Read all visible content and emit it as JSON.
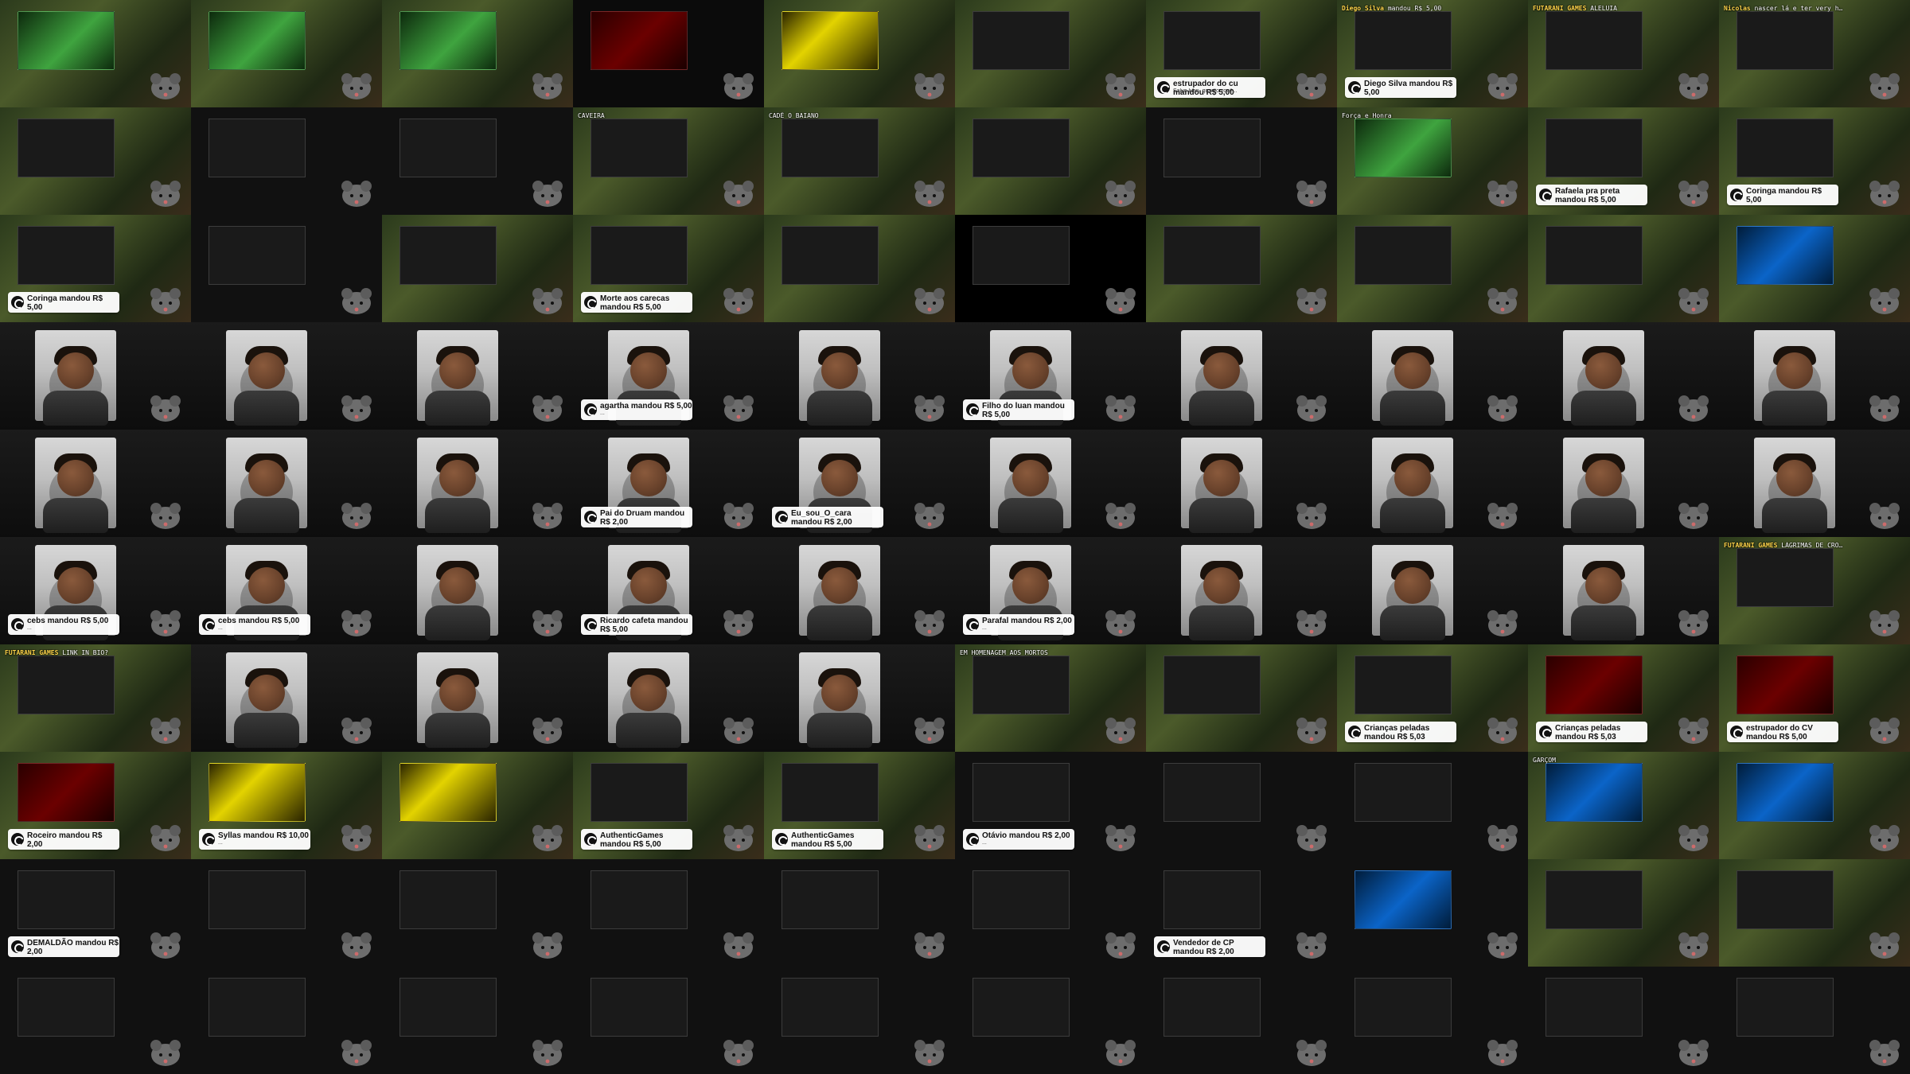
{
  "tiles": [
    {
      "row": 0,
      "col": 0,
      "kind": "jungle",
      "thumb": "green",
      "badge": "",
      "chat": [],
      "toast": null
    },
    {
      "row": 0,
      "col": 1,
      "kind": "jungle",
      "thumb": "green",
      "badge": "",
      "chat": [],
      "toast": null
    },
    {
      "row": 0,
      "col": 2,
      "kind": "jungle",
      "thumb": "green",
      "badge": "",
      "chat": [],
      "toast": null
    },
    {
      "row": 0,
      "col": 3,
      "kind": "news",
      "thumb": "red",
      "badge": "",
      "chat": [],
      "toast": null
    },
    {
      "row": 0,
      "col": 4,
      "kind": "jungle",
      "thumb": "yellow",
      "badge": "",
      "chat": [],
      "toast": null
    },
    {
      "row": 0,
      "col": 5,
      "kind": "jungle",
      "thumb": "dark",
      "badge": "",
      "chat": [],
      "toast": null
    },
    {
      "row": 0,
      "col": 6,
      "kind": "jungle",
      "thumb": "dark",
      "badge": "",
      "chat": [],
      "toast": {
        "title": "estrupador do cu mandou R$ 5,00",
        "body": "Salve luan, quanto você..."
      }
    },
    {
      "row": 0,
      "col": 7,
      "kind": "jungle",
      "thumb": "dark",
      "badge": "",
      "chat": [
        {
          "u": "Diego Silva",
          "m": "mandou R$ 5,00"
        }
      ],
      "toast": {
        "title": "Diego Silva mandou R$ 5,00",
        "body": "..."
      }
    },
    {
      "row": 0,
      "col": 8,
      "kind": "jungle",
      "thumb": "dark",
      "badge": "",
      "chat": [
        {
          "u": "FUTARANI GAMES",
          "m": "ALELUIA"
        }
      ],
      "toast": null
    },
    {
      "row": 0,
      "col": 9,
      "kind": "jungle",
      "thumb": "dark",
      "badge": "",
      "chat": [
        {
          "u": "Nicolas",
          "m": "nascer lá e ter very hard"
        }
      ],
      "toast": null
    },
    {
      "row": 1,
      "col": 0,
      "kind": "jungle",
      "thumb": "dark",
      "badge": "",
      "chat": [],
      "toast": null
    },
    {
      "row": 1,
      "col": 1,
      "kind": "dark",
      "thumb": "dark",
      "badge": "",
      "chat": [],
      "toast": null
    },
    {
      "row": 1,
      "col": 2,
      "kind": "dark",
      "thumb": "dark",
      "badge": "",
      "chat": [],
      "toast": null
    },
    {
      "row": 1,
      "col": 3,
      "kind": "jungle",
      "thumb": "dark",
      "badge": "",
      "chat": [
        {
          "u": "",
          "m": "CAVEIRA"
        }
      ],
      "toast": null
    },
    {
      "row": 1,
      "col": 4,
      "kind": "jungle",
      "thumb": "dark",
      "badge": "",
      "chat": [
        {
          "u": "",
          "m": "CADÊ O BAIANO"
        }
      ],
      "toast": null
    },
    {
      "row": 1,
      "col": 5,
      "kind": "jungle",
      "thumb": "dark",
      "badge": "",
      "chat": [],
      "toast": null
    },
    {
      "row": 1,
      "col": 6,
      "kind": "dark",
      "thumb": "dark",
      "badge": "",
      "chat": [],
      "toast": null
    },
    {
      "row": 1,
      "col": 7,
      "kind": "jungle",
      "thumb": "green",
      "badge": "",
      "chat": [
        {
          "u": "",
          "m": "Força e Honra"
        }
      ],
      "toast": null
    },
    {
      "row": 1,
      "col": 8,
      "kind": "jungle",
      "thumb": "dark",
      "badge": "",
      "chat": [],
      "toast": {
        "title": "Rafaela pra preta mandou R$ 5,00",
        "body": "..."
      }
    },
    {
      "row": 1,
      "col": 9,
      "kind": "jungle",
      "thumb": "dark",
      "badge": "",
      "chat": [],
      "toast": {
        "title": "Coringa mandou R$ 5,00",
        "body": "..."
      }
    },
    {
      "row": 2,
      "col": 0,
      "kind": "jungle",
      "thumb": "dark",
      "badge": "",
      "chat": [],
      "toast": {
        "title": "Coringa mandou R$ 5,00",
        "body": "..."
      }
    },
    {
      "row": 2,
      "col": 1,
      "kind": "dark",
      "thumb": "dark",
      "badge": "",
      "chat": [],
      "toast": null
    },
    {
      "row": 2,
      "col": 2,
      "kind": "jungle",
      "thumb": "dark",
      "badge": "",
      "chat": [],
      "toast": null
    },
    {
      "row": 2,
      "col": 3,
      "kind": "jungle",
      "thumb": "dark",
      "badge": "",
      "chat": [],
      "toast": {
        "title": "Morte aos carecas mandou R$ 5,00",
        "body": "..."
      }
    },
    {
      "row": 2,
      "col": 4,
      "kind": "jungle",
      "thumb": "dark",
      "badge": "",
      "chat": [],
      "toast": null
    },
    {
      "row": 2,
      "col": 5,
      "kind": "black",
      "thumb": "dark",
      "badge": "",
      "chat": [],
      "toast": null
    },
    {
      "row": 2,
      "col": 6,
      "kind": "jungle",
      "thumb": "dark",
      "badge": "",
      "chat": [],
      "toast": null
    },
    {
      "row": 2,
      "col": 7,
      "kind": "jungle",
      "thumb": "dark",
      "badge": "",
      "chat": [],
      "toast": null
    },
    {
      "row": 2,
      "col": 8,
      "kind": "jungle",
      "thumb": "dark",
      "badge": "",
      "chat": [],
      "toast": null
    },
    {
      "row": 2,
      "col": 9,
      "kind": "jungle",
      "thumb": "blue",
      "badge": "",
      "chat": [],
      "toast": null
    },
    {
      "row": 3,
      "col": 0,
      "kind": "room",
      "thumb": "blue",
      "badge": "",
      "chat": [],
      "toast": null
    },
    {
      "row": 3,
      "col": 1,
      "kind": "room",
      "thumb": null,
      "badge": "",
      "chat": [],
      "toast": null
    },
    {
      "row": 3,
      "col": 2,
      "kind": "room",
      "thumb": null,
      "badge": "",
      "chat": [],
      "toast": null
    },
    {
      "row": 3,
      "col": 3,
      "kind": "room",
      "thumb": null,
      "badge": "",
      "chat": [],
      "toast": {
        "title": "agartha mandou R$ 5,00",
        "body": "..."
      }
    },
    {
      "row": 3,
      "col": 4,
      "kind": "room",
      "thumb": null,
      "badge": "",
      "chat": [],
      "toast": null
    },
    {
      "row": 3,
      "col": 5,
      "kind": "room",
      "thumb": "yellow",
      "badge": "",
      "chat": [],
      "toast": {
        "title": "Filho do luan mandou R$ 5,00",
        "body": "..."
      }
    },
    {
      "row": 3,
      "col": 6,
      "kind": "room",
      "thumb": null,
      "badge": "",
      "chat": [],
      "toast": null
    },
    {
      "row": 3,
      "col": 7,
      "kind": "room",
      "thumb": null,
      "badge": "",
      "chat": [],
      "toast": null
    },
    {
      "row": 3,
      "col": 8,
      "kind": "room",
      "thumb": null,
      "badge": "",
      "chat": [],
      "toast": null
    },
    {
      "row": 3,
      "col": 9,
      "kind": "room",
      "thumb": null,
      "badge": "",
      "chat": [],
      "toast": null
    },
    {
      "row": 4,
      "col": 0,
      "kind": "room",
      "thumb": null,
      "badge": "",
      "chat": [],
      "toast": null
    },
    {
      "row": 4,
      "col": 1,
      "kind": "room",
      "thumb": null,
      "badge": "",
      "chat": [],
      "toast": null
    },
    {
      "row": 4,
      "col": 2,
      "kind": "room",
      "thumb": null,
      "badge": "",
      "chat": [],
      "toast": null
    },
    {
      "row": 4,
      "col": 3,
      "kind": "room",
      "thumb": null,
      "badge": "",
      "chat": [],
      "toast": {
        "title": "Pai do Druam mandou R$ 2,00",
        "body": "..."
      }
    },
    {
      "row": 4,
      "col": 4,
      "kind": "room",
      "thumb": null,
      "badge": "",
      "chat": [],
      "toast": {
        "title": "Eu_sou_O_cara mandou R$ 2,00",
        "body": "..."
      }
    },
    {
      "row": 4,
      "col": 5,
      "kind": "room",
      "thumb": null,
      "badge": "",
      "chat": [],
      "toast": null
    },
    {
      "row": 4,
      "col": 6,
      "kind": "room",
      "thumb": null,
      "badge": "",
      "chat": [],
      "toast": null
    },
    {
      "row": 4,
      "col": 7,
      "kind": "room",
      "thumb": null,
      "badge": "",
      "chat": [],
      "toast": null
    },
    {
      "row": 4,
      "col": 8,
      "kind": "room",
      "thumb": null,
      "badge": "",
      "chat": [],
      "toast": null
    },
    {
      "row": 4,
      "col": 9,
      "kind": "room",
      "thumb": null,
      "badge": "",
      "chat": [],
      "toast": null
    },
    {
      "row": 5,
      "col": 0,
      "kind": "room",
      "thumb": null,
      "badge": "",
      "chat": [],
      "toast": {
        "title": "cebs mandou R$ 5,00",
        "body": "..."
      }
    },
    {
      "row": 5,
      "col": 1,
      "kind": "room",
      "thumb": null,
      "badge": "",
      "chat": [],
      "toast": {
        "title": "cebs mandou R$ 5,00",
        "body": "..."
      }
    },
    {
      "row": 5,
      "col": 2,
      "kind": "room",
      "thumb": null,
      "badge": "",
      "chat": [],
      "toast": null
    },
    {
      "row": 5,
      "col": 3,
      "kind": "room",
      "thumb": null,
      "badge": "",
      "chat": [],
      "toast": {
        "title": "Ricardo cafeta mandou R$ 5,00",
        "body": "..."
      }
    },
    {
      "row": 5,
      "col": 4,
      "kind": "room",
      "thumb": null,
      "badge": "",
      "chat": [],
      "toast": null
    },
    {
      "row": 5,
      "col": 5,
      "kind": "room",
      "thumb": null,
      "badge": "",
      "chat": [],
      "toast": {
        "title": "Parafal mandou R$ 2,00",
        "body": "..."
      }
    },
    {
      "row": 5,
      "col": 6,
      "kind": "room",
      "thumb": null,
      "badge": "",
      "chat": [],
      "toast": null
    },
    {
      "row": 5,
      "col": 7,
      "kind": "room",
      "thumb": null,
      "badge": "",
      "chat": [],
      "toast": null
    },
    {
      "row": 5,
      "col": 8,
      "kind": "room",
      "thumb": null,
      "badge": "",
      "chat": [],
      "toast": null
    },
    {
      "row": 5,
      "col": 9,
      "kind": "jungle",
      "thumb": "dark",
      "badge": "",
      "chat": [
        {
          "u": "FUTARANI GAMES",
          "m": "LÁGRIMAS DE CROCODILO"
        }
      ],
      "toast": null
    },
    {
      "row": 6,
      "col": 0,
      "kind": "jungle",
      "thumb": "dark",
      "badge": "",
      "chat": [
        {
          "u": "FUTARANI GAMES",
          "m": "LINK IN BIO?"
        }
      ],
      "toast": null
    },
    {
      "row": 6,
      "col": 1,
      "kind": "room",
      "thumb": null,
      "badge": "",
      "chat": [],
      "toast": null
    },
    {
      "row": 6,
      "col": 2,
      "kind": "room",
      "thumb": null,
      "badge": "",
      "chat": [],
      "toast": null
    },
    {
      "row": 6,
      "col": 3,
      "kind": "room",
      "thumb": null,
      "badge": "",
      "chat": [],
      "toast": null
    },
    {
      "row": 6,
      "col": 4,
      "kind": "room",
      "thumb": null,
      "badge": "",
      "chat": [],
      "toast": null
    },
    {
      "row": 6,
      "col": 5,
      "kind": "jungle",
      "thumb": "dark",
      "badge": "",
      "chat": [
        {
          "u": "",
          "m": "EM HOMENAGEM AOS MORTOS"
        }
      ],
      "toast": null
    },
    {
      "row": 6,
      "col": 6,
      "kind": "jungle",
      "thumb": "dark",
      "badge": "",
      "chat": [],
      "toast": null
    },
    {
      "row": 6,
      "col": 7,
      "kind": "jungle",
      "thumb": "dark",
      "badge": "",
      "chat": [],
      "toast": {
        "title": "Crianças peladas mandou R$ 5,03",
        "body": "..."
      }
    },
    {
      "row": 6,
      "col": 8,
      "kind": "jungle",
      "thumb": "red",
      "badge": "",
      "chat": [],
      "toast": {
        "title": "Crianças peladas mandou R$ 5,03",
        "body": "..."
      }
    },
    {
      "row": 6,
      "col": 9,
      "kind": "jungle",
      "thumb": "red",
      "badge": "",
      "chat": [],
      "toast": {
        "title": "estrupador do CV mandou R$ 5,00",
        "body": "..."
      }
    },
    {
      "row": 7,
      "col": 0,
      "kind": "jungle",
      "thumb": "red",
      "badge": "",
      "chat": [],
      "toast": {
        "title": "Roceiro mandou R$ 2,00",
        "body": "..."
      }
    },
    {
      "row": 7,
      "col": 1,
      "kind": "jungle",
      "thumb": "yellow",
      "badge": "",
      "chat": [],
      "toast": {
        "title": "Syllas mandou R$ 10,00",
        "body": "..."
      }
    },
    {
      "row": 7,
      "col": 2,
      "kind": "jungle",
      "thumb": "yellow",
      "badge": "",
      "chat": [],
      "toast": null
    },
    {
      "row": 7,
      "col": 3,
      "kind": "jungle",
      "thumb": "dark",
      "badge": "",
      "chat": [],
      "toast": {
        "title": "AuthenticGames mandou R$ 5,00",
        "body": "..."
      }
    },
    {
      "row": 7,
      "col": 4,
      "kind": "jungle",
      "thumb": "dark",
      "badge": "",
      "chat": [],
      "toast": {
        "title": "AuthenticGames mandou R$ 5,00",
        "body": "..."
      }
    },
    {
      "row": 7,
      "col": 5,
      "kind": "dark",
      "thumb": "dark",
      "badge": "",
      "chat": [],
      "toast": {
        "title": "Otávio mandou R$ 2,00",
        "body": "..."
      }
    },
    {
      "row": 7,
      "col": 6,
      "kind": "dark",
      "thumb": "dark",
      "badge": "",
      "chat": [],
      "toast": null
    },
    {
      "row": 7,
      "col": 7,
      "kind": "dark",
      "thumb": "dark",
      "badge": "",
      "chat": [],
      "toast": null
    },
    {
      "row": 7,
      "col": 8,
      "kind": "jungle",
      "thumb": "blue",
      "badge": "",
      "chat": [
        {
          "u": "",
          "m": "GARÇOM"
        }
      ],
      "toast": null
    },
    {
      "row": 7,
      "col": 9,
      "kind": "jungle",
      "thumb": "blue",
      "badge": "",
      "chat": [],
      "toast": null
    },
    {
      "row": 8,
      "col": 0,
      "kind": "dark",
      "thumb": "dark",
      "badge": "",
      "chat": [],
      "toast": {
        "title": "DEMALDÃO mandou R$ 2,00",
        "body": "..."
      }
    },
    {
      "row": 8,
      "col": 1,
      "kind": "dark",
      "thumb": "dark",
      "badge": "",
      "chat": [],
      "toast": null
    },
    {
      "row": 8,
      "col": 2,
      "kind": "dark",
      "thumb": "dark",
      "badge": "",
      "chat": [],
      "toast": null
    },
    {
      "row": 8,
      "col": 3,
      "kind": "dark",
      "thumb": "dark",
      "badge": "",
      "chat": [],
      "toast": null
    },
    {
      "row": 8,
      "col": 4,
      "kind": "dark",
      "thumb": "dark",
      "badge": "",
      "chat": [],
      "toast": null
    },
    {
      "row": 8,
      "col": 5,
      "kind": "dark",
      "thumb": "dark",
      "badge": "",
      "chat": [],
      "toast": null
    },
    {
      "row": 8,
      "col": 6,
      "kind": "dark",
      "thumb": "dark",
      "badge": "",
      "chat": [],
      "toast": {
        "title": "Vendedor de CP mandou R$ 2,00",
        "body": "..."
      }
    },
    {
      "row": 8,
      "col": 7,
      "kind": "dark",
      "thumb": "blue",
      "badge": "",
      "chat": [],
      "toast": null
    },
    {
      "row": 8,
      "col": 8,
      "kind": "jungle",
      "thumb": "dark",
      "badge": "",
      "chat": [],
      "toast": null
    },
    {
      "row": 8,
      "col": 9,
      "kind": "jungle",
      "thumb": "dark",
      "badge": "",
      "chat": [],
      "toast": null
    },
    {
      "row": 9,
      "col": 0,
      "kind": "dark",
      "thumb": "dark",
      "badge": "",
      "chat": [],
      "toast": null
    },
    {
      "row": 9,
      "col": 1,
      "kind": "dark",
      "thumb": "dark",
      "badge": "",
      "chat": [],
      "toast": null
    },
    {
      "row": 9,
      "col": 2,
      "kind": "dark",
      "thumb": "dark",
      "badge": "",
      "chat": [],
      "toast": null
    },
    {
      "row": 9,
      "col": 3,
      "kind": "dark",
      "thumb": "dark",
      "badge": "",
      "chat": [],
      "toast": null
    },
    {
      "row": 9,
      "col": 4,
      "kind": "dark",
      "thumb": "dark",
      "badge": "",
      "chat": [],
      "toast": null
    },
    {
      "row": 9,
      "col": 5,
      "kind": "dark",
      "thumb": "dark",
      "badge": "",
      "chat": [],
      "toast": null
    },
    {
      "row": 9,
      "col": 6,
      "kind": "dark",
      "thumb": "dark",
      "badge": "",
      "chat": [],
      "toast": null
    },
    {
      "row": 9,
      "col": 7,
      "kind": "dark",
      "thumb": "dark",
      "badge": "",
      "chat": [],
      "toast": null
    },
    {
      "row": 9,
      "col": 8,
      "kind": "dark",
      "thumb": "dark",
      "badge": "",
      "chat": [],
      "toast": null
    },
    {
      "row": 9,
      "col": 9,
      "kind": "dark",
      "thumb": "dark",
      "badge": "",
      "chat": [],
      "toast": null
    }
  ]
}
